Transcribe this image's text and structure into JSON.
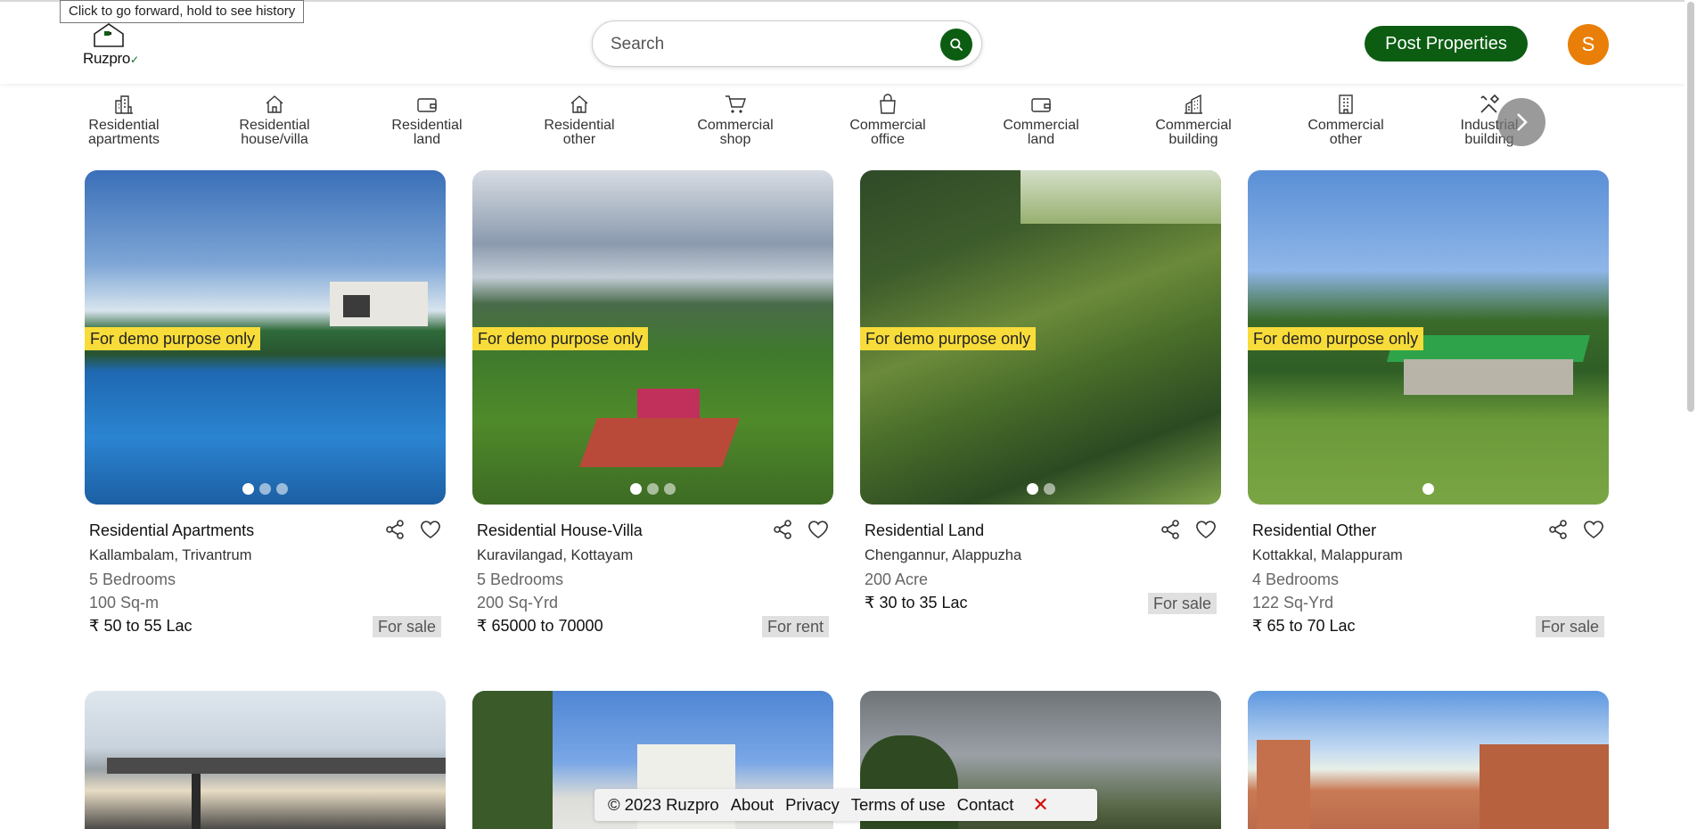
{
  "tooltip": "Click to go forward, hold to see history",
  "header": {
    "logo_text": "Ruzpro",
    "search_placeholder": "Search",
    "post_label": "Post Properties",
    "avatar_letter": "S",
    "brand_color": "#0c5d12",
    "avatar_color": "#e97f09"
  },
  "categories": [
    {
      "label1": "Residential",
      "label2": "apartments",
      "icon": "building-icon"
    },
    {
      "label1": "Residential",
      "label2": "house/villa",
      "icon": "house-icon"
    },
    {
      "label1": "Residential",
      "label2": "land",
      "icon": "wallet-icon"
    },
    {
      "label1": "Residential",
      "label2": "other",
      "icon": "house-icon"
    },
    {
      "label1": "Commercial",
      "label2": "shop",
      "icon": "cart-icon"
    },
    {
      "label1": "Commercial",
      "label2": "office",
      "icon": "bag-icon"
    },
    {
      "label1": "Commercial",
      "label2": "land",
      "icon": "wallet-icon"
    },
    {
      "label1": "Commercial",
      "label2": "building",
      "icon": "buildings-icon"
    },
    {
      "label1": "Commercial",
      "label2": "other",
      "icon": "office-building-icon"
    },
    {
      "label1": "Industrial",
      "label2": "building",
      "icon": "tools-icon"
    }
  ],
  "cards": [
    {
      "tag": "For demo purpose only",
      "title": "Residential Apartments",
      "location": "Kallambalam, Trivantrum",
      "bedrooms": "5 Bedrooms",
      "area": "100 Sq-m",
      "price": "₹ 50 to 55 Lac",
      "status": "For sale",
      "dot_count": 3
    },
    {
      "tag": "For demo purpose only",
      "title": "Residential House-Villa",
      "location": "Kuravilangad, Kottayam",
      "bedrooms": "5 Bedrooms",
      "area": "200 Sq-Yrd",
      "price": "₹ 65000 to 70000",
      "status": "For rent",
      "dot_count": 3
    },
    {
      "tag": "For demo purpose only",
      "title": "Residential Land",
      "location": "Chengannur, Alappuzha",
      "area": "200 Acre",
      "price": "₹ 30 to 35 Lac",
      "status": "For sale",
      "dot_count": 2
    },
    {
      "tag": "For demo purpose only",
      "title": "Residential Other",
      "location": "Kottakkal, Malappuram",
      "bedrooms": "4 Bedrooms",
      "area": "122 Sq-Yrd",
      "price": "₹ 65 to 70 Lac",
      "status": "For sale",
      "dot_count": 1
    }
  ],
  "footer": {
    "copyright": "© 2023 Ruzpro",
    "about": "About",
    "privacy": "Privacy",
    "terms": "Terms of use",
    "contact": "Contact",
    "close": "✕"
  }
}
